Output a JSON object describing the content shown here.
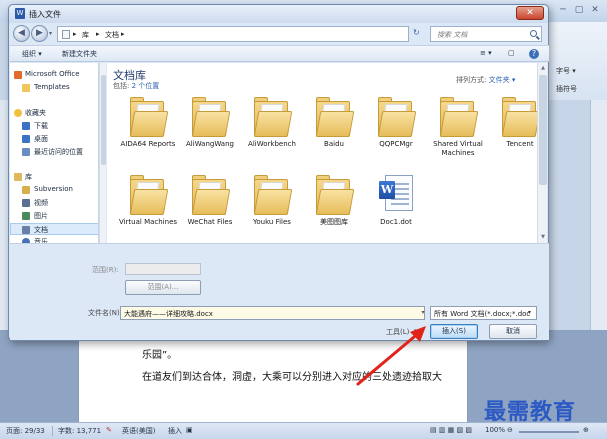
{
  "dialog": {
    "title": "插入文件",
    "close_glyph": "✕"
  },
  "nav": {
    "back_glyph": "◀",
    "forward_glyph": "▶",
    "history_glyph": "▾",
    "address": [
      "库",
      "文档"
    ],
    "address_sep": "▸",
    "address_drop_glyph": "▾",
    "refresh_glyph": "↻",
    "search_placeholder": "搜索 文档"
  },
  "toolbar": {
    "organize": "组织 ▾",
    "new_folder": "新建文件夹",
    "views_glyph": "≡ ▾",
    "preview_glyph": "▢",
    "help_glyph": "?"
  },
  "sidebar": {
    "items": [
      {
        "label": "Microsoft Office",
        "color": "#e26b2c"
      },
      {
        "label": "Templates",
        "color": "#f0c75e"
      },
      {
        "label": "收藏夹",
        "color": "#f0c040"
      },
      {
        "label": "下载",
        "color": "#3a72c4"
      },
      {
        "label": "桌面",
        "color": "#3a72c4"
      },
      {
        "label": "最近访问的位置",
        "color": "#6a8cc0"
      },
      {
        "label": "库",
        "color": "#e0b860"
      },
      {
        "label": "Subversion",
        "color": "#d7b04c"
      },
      {
        "label": "视频",
        "color": "#5a6f92"
      },
      {
        "label": "图片",
        "color": "#4a8a5a"
      },
      {
        "label": "文档",
        "color": "#6a7fa6"
      },
      {
        "label": "音乐",
        "color": "#4a6fb6"
      }
    ]
  },
  "library": {
    "title": "文档库",
    "subtitle_prefix": "包括:",
    "subtitle_link": "2 个位置",
    "arrange_label": "排列方式:",
    "arrange_value": "文件夹 ▾"
  },
  "files": [
    {
      "name": "AIDA64 Reports",
      "kind": "folder"
    },
    {
      "name": "AliWangWang",
      "kind": "folder"
    },
    {
      "name": "AliWorkbench",
      "kind": "folder"
    },
    {
      "name": "Baidu",
      "kind": "folder"
    },
    {
      "name": "QQPCMgr",
      "kind": "folder"
    },
    {
      "name": "Shared Virtual Machines",
      "kind": "folder"
    },
    {
      "name": "Tencent",
      "kind": "folder"
    },
    {
      "name": "Virtual Machines",
      "kind": "folder"
    },
    {
      "name": "WeChat Files",
      "kind": "folder"
    },
    {
      "name": "Youku Files",
      "kind": "folder"
    },
    {
      "name": "美图图库",
      "kind": "folder"
    },
    {
      "name": "Doc1.dot",
      "kind": "doc"
    }
  ],
  "form": {
    "range_label": "范围(R):",
    "range_button": "范围(A)...",
    "filename_label": "文件名(N):",
    "filename_value": "大能遇府——详细攻略.docx",
    "filetype_value": "所有 Word 文档(*.docx;*.doc",
    "tools_label": "工具(L)",
    "insert_button": "插入(S)",
    "cancel_button": "取消",
    "dropdown_glyph": "▾"
  },
  "word": {
    "ribbon_text_1": "字号 ▾",
    "ribbon_text_2": "插符号",
    "doc_line_1": "乐园”。",
    "doc_line_2": "在道友们到达合体，洞虚，大乘可以分别进入对应的三处遗迹拾取大",
    "min_glyph": "─",
    "max_glyph": "▢",
    "close_glyph": "✕"
  },
  "status": {
    "page": "页面: 29/33",
    "words": "字数: 13,771",
    "lang": "英语(美国)",
    "mode": "插入",
    "zoom": "100%",
    "zoom_minus": "⊖",
    "zoom_plus": "⊕"
  },
  "watermark": "最需教育"
}
